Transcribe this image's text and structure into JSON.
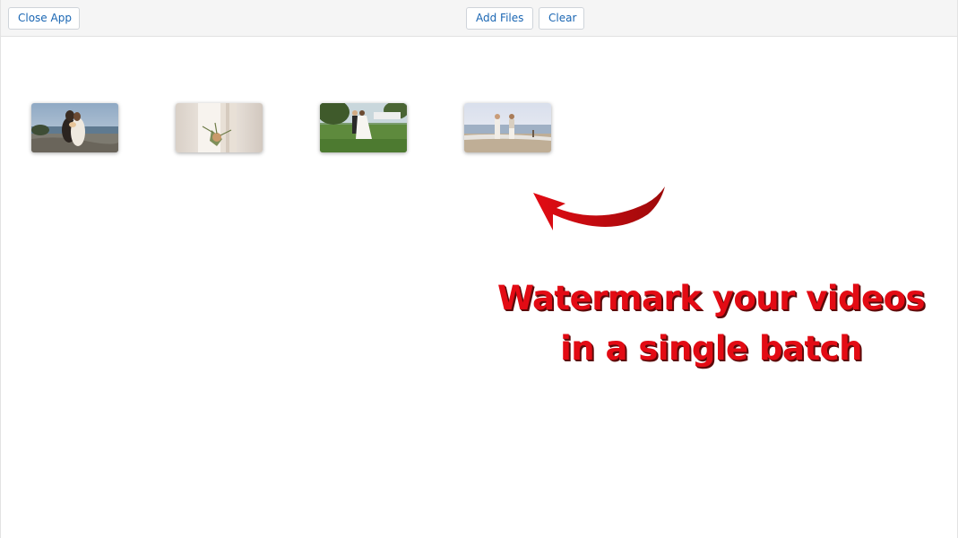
{
  "toolbar": {
    "close_label": "Close App",
    "add_label": "Add Files",
    "clear_label": "Clear"
  },
  "thumbnails": [
    {
      "name": "video-thumbnail-1",
      "description_icon": "couple-kissing-seaside"
    },
    {
      "name": "video-thumbnail-2",
      "description_icon": "bride-bouquet"
    },
    {
      "name": "video-thumbnail-3",
      "description_icon": "couple-dancing-lawn"
    },
    {
      "name": "video-thumbnail-4",
      "description_icon": "couple-on-beach"
    }
  ],
  "promo": {
    "line1": "Watermark your videos",
    "line2": "in a single batch",
    "color": "#e30b14"
  }
}
